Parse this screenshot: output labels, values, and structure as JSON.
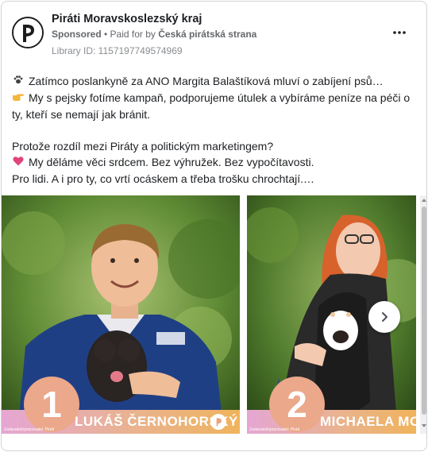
{
  "page": {
    "name": "Piráti Moravskoslezský kraj",
    "sponsored": "Sponsored",
    "paid_prefix": " • Paid for by ",
    "payer": "Česká pirátská strana",
    "library_id": "Library ID: 1157197749574969"
  },
  "post": {
    "line1": "Zatímco poslankyně za ANO Margita Balaštíková mluví o zabíjení psů…",
    "line2": "My s pejsky fotíme kampaň, podporujeme útulek a vybíráme peníze na péči o",
    "line3": "ty, kteří se nemají jak bránit.",
    "line4": "Protože rozdíl mezi Piráty a politickým marketingem?",
    "line5": "My děláme věci srdcem. Bez výhružek. Bez vypočítavosti.",
    "line6": "Pro lidi. A i pro ty, co vrtí ocáskem a třeba trošku chrochtají.…"
  },
  "carousel": {
    "slides": [
      {
        "number": "1",
        "name": "LUKÁŠ ČERNOHORSKÝ",
        "claim": "Zadavatel/zpracovatel: Piráti"
      },
      {
        "number": "2",
        "name": "MICHAELA MORICOVÁ",
        "claim": "Zadavatel/zpracovatel: Piráti"
      }
    ]
  },
  "icons": {
    "paw": "paw-icon",
    "point": "pointing-hand-icon",
    "heart": "heart-icon",
    "more": "more-options-icon",
    "next": "chevron-right-icon"
  },
  "colors": {
    "strip_start": "#e6a6d4",
    "strip_end": "#f0b35c",
    "number_circle": "#eba88a",
    "pirate_black": "#1c1c1c"
  }
}
